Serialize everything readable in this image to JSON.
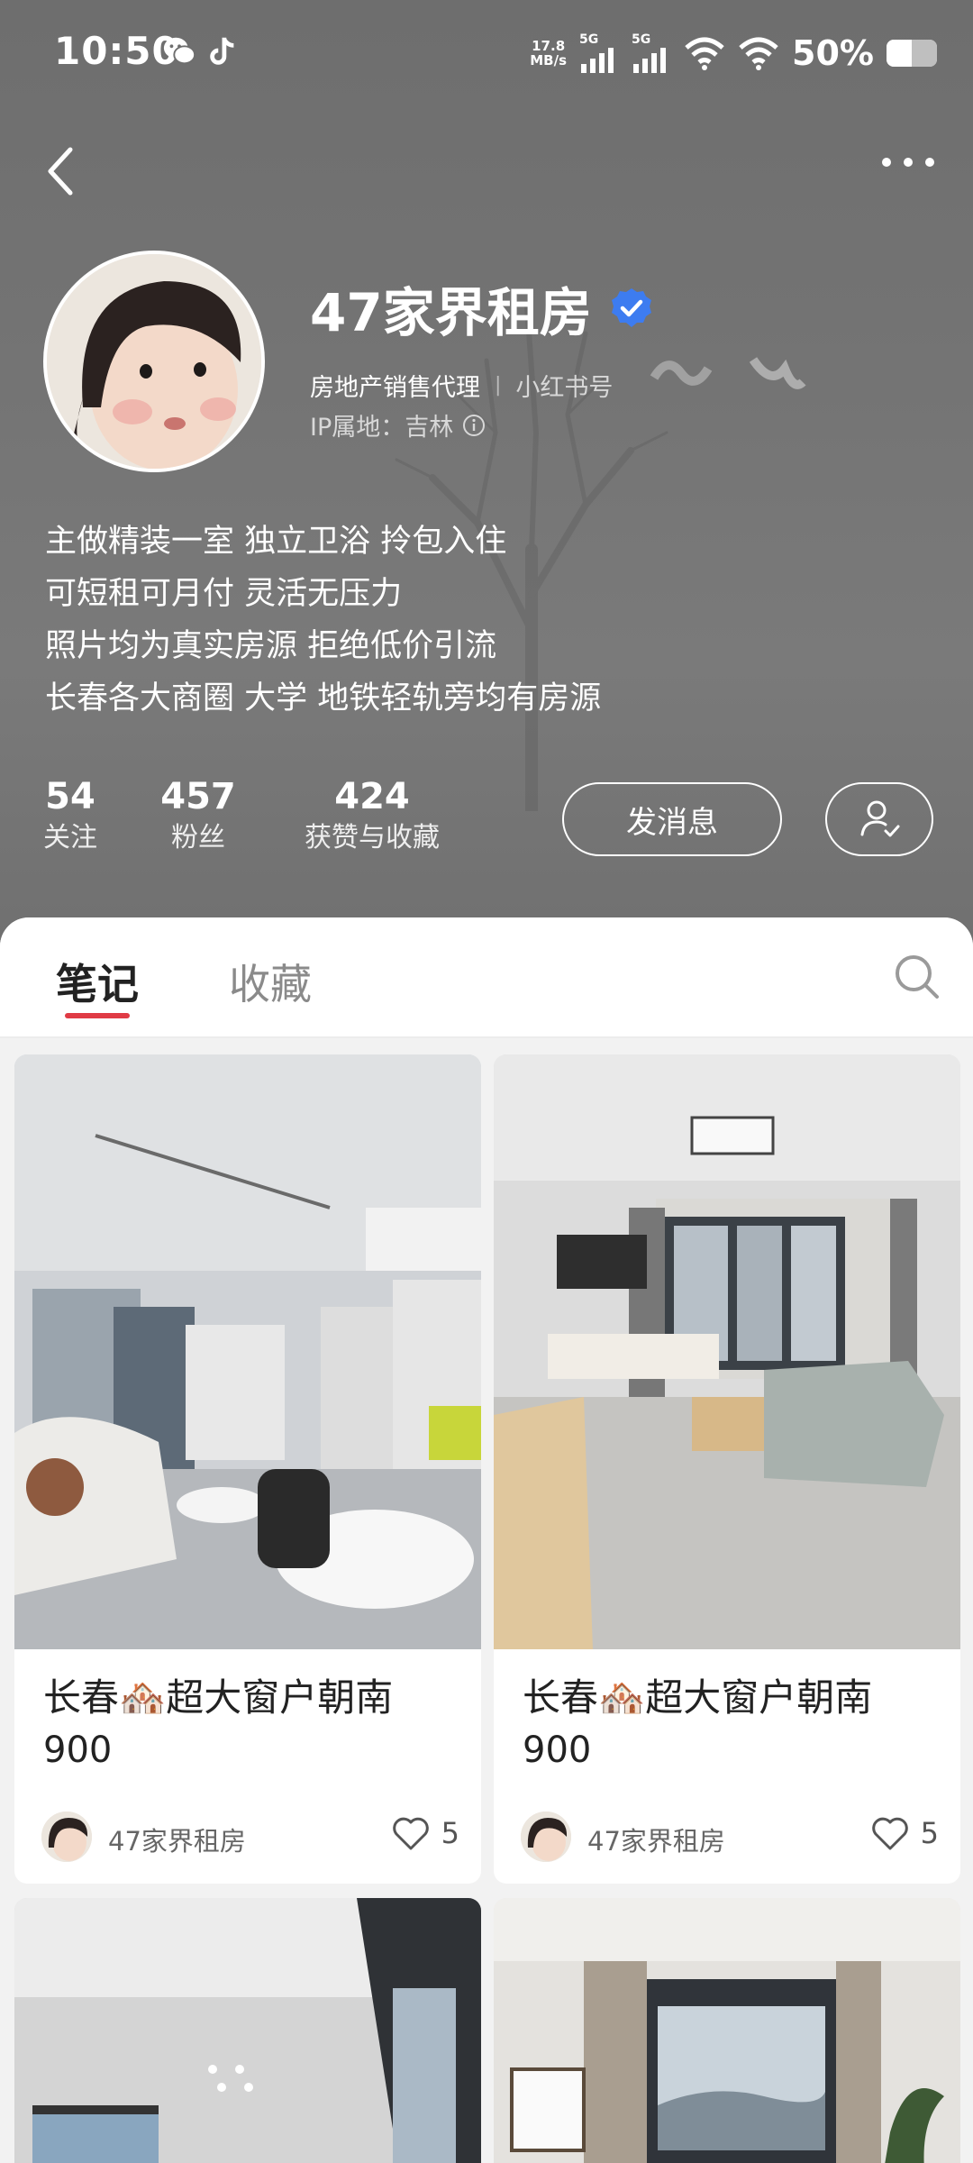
{
  "status_bar": {
    "time": "10:50",
    "net_speed_value": "17.8",
    "net_speed_unit": "MB/s",
    "sim1": "5G",
    "sim2": "5G",
    "battery": "50%",
    "battery_level": 0.5,
    "icons": [
      "wechat-icon",
      "tiktok-icon",
      "signal-icon",
      "wifi-icon",
      "battery-icon"
    ]
  },
  "nav": {
    "back_icon": "chevron-left-icon",
    "more_icon": "more-dots-icon"
  },
  "profile": {
    "name": "47家界租房",
    "verified": true,
    "category": "房地产销售代理",
    "separator": "|",
    "redbook_id_label": "小红书号",
    "ip_location": "IP属地：吉林",
    "bio": [
      "主做精装一室 独立卫浴 拎包入住",
      "可短租可月付 灵活无压力",
      "照片均为真实房源 拒绝低价引流",
      "长春各大商圈 大学 地铁轻轨旁均有房源"
    ],
    "stats": [
      {
        "value": "54",
        "label": "关注"
      },
      {
        "value": "457",
        "label": "粉丝"
      },
      {
        "value": "424",
        "label": "获赞与收藏"
      }
    ],
    "message_button": "发消息"
  },
  "tabs": [
    {
      "label": "笔记",
      "active": true
    },
    {
      "label": "收藏",
      "active": false
    }
  ],
  "notes": [
    {
      "title": "长春🏘️超大窗户朝南",
      "price": "900",
      "author": "47家界租房",
      "likes": "5"
    },
    {
      "title": "长春🏘️超大窗户朝南",
      "price": "900",
      "author": "47家界租房",
      "likes": "5"
    }
  ],
  "colors": {
    "accent": "#e03b45",
    "verified": "#3d7cf0",
    "header_bg": "#737373"
  }
}
